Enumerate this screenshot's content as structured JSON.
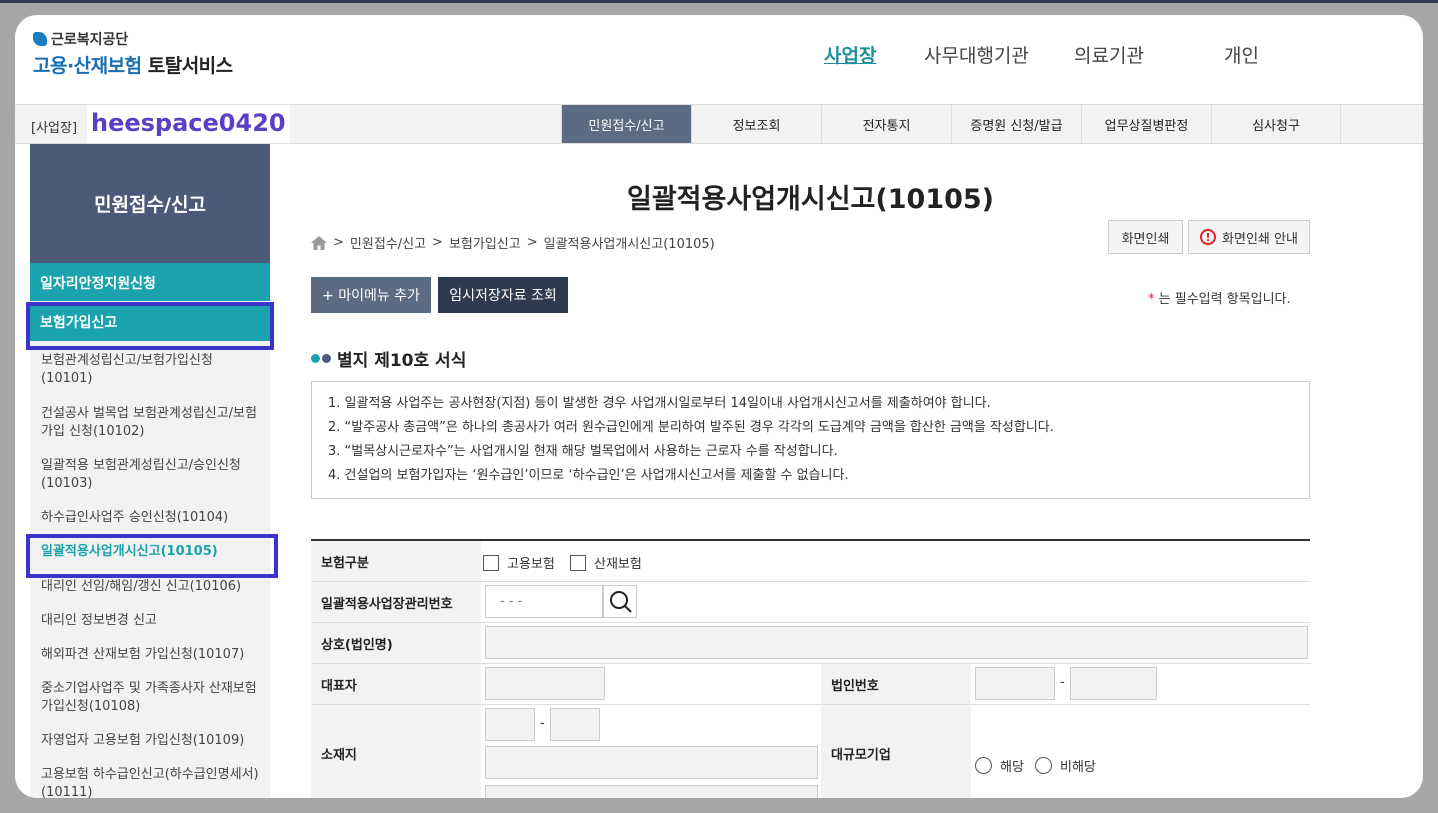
{
  "header": {
    "org_small": "근로복지공단",
    "logo_main_1": "고용·산재보험",
    "logo_main_2": "토탈서비스",
    "gnb": [
      {
        "label": "사업장"
      },
      {
        "label": "사무대행기관"
      },
      {
        "label": "의료기관"
      },
      {
        "label": "개인"
      }
    ]
  },
  "subbar": {
    "biz_label": "[사업장]",
    "user_id": "heespace0420",
    "tabs": [
      {
        "label": "민원접수/신고"
      },
      {
        "label": "정보조회"
      },
      {
        "label": "전자통지"
      },
      {
        "label": "증명원 신청/발급"
      },
      {
        "label": "업무상질병판정"
      },
      {
        "label": "심사청구"
      }
    ]
  },
  "lnb": {
    "head": "민원접수/신고",
    "category": "일자리안정지원신청",
    "sub": "보험가입신고",
    "items": [
      {
        "label": "보험관계성립신고/보험가입신청(10101)"
      },
      {
        "label": "건설공사 벌목업 보험관계성립신고/보험가입 신청(10102)"
      },
      {
        "label": "일괄적용 보험관계성립신고/승인신청(10103)"
      },
      {
        "label": "하수급인사업주 승인신청(10104)"
      },
      {
        "label": "일괄적용사업개시신고(10105)"
      },
      {
        "label": "대리인 선임/해임/갱신 신고(10106)"
      },
      {
        "label": "대리인 정보변경 신고"
      },
      {
        "label": "해외파견 산재보험 가입신청(10107)"
      },
      {
        "label": "중소기업사업주 및 가족종사자 산재보험가입신청(10108)"
      },
      {
        "label": "자영업자 고용보험 가입신청(10109)"
      },
      {
        "label": "고용보험 하수급인신고(하수급인명세서)(10111)"
      }
    ]
  },
  "main": {
    "title": "일괄적용사업개시신고(10105)",
    "breadcrumb": [
      "민원접수/신고",
      "보험가입신고",
      "일괄적용사업개시신고(10105)"
    ],
    "print_label": "화면인쇄",
    "print_guide_label": "화면인쇄 안내",
    "mymenu_label": "+ 마이메뉴 추가",
    "temp_label": "임시저장자료 조회",
    "req_note": "는 필수입력 항목입니다.",
    "req_star": "*",
    "section_title": "별지 제10호 서식",
    "notices": [
      "1. 일괄적용 사업주는 공사현장(지점) 등이 발생한 경우 사업개시일로부터 14일이내 사업개시신고서를 제출하여야 합니다.",
      "2. “발주공사 총금액”은 하나의 총공사가 여러 원수급인에게 분리하여 발주된 경우 각각의 도급계약 금액을 합산한 금액을 작성합니다.",
      "3. “벌목상시근로자수”는 사업개시일 현재 해당 벌목업에서 사용하는 근로자 수를 작성합니다.",
      "4. 건설업의 보험가입자는 ‘원수급인’이므로 ‘하수급인’은 사업개시신고서를 제출할 수 없습니다."
    ]
  },
  "form": {
    "insurance_type_label": "보험구분",
    "opt_employment": "고용보험",
    "opt_industrial": "산재보험",
    "mgmt_no_label": "일괄적용사업장관리번호",
    "mgmt_no_placeholder": "- -   -",
    "company_label": "상호(법인명)",
    "rep_label": "대표자",
    "corp_no_label": "법인번호",
    "dash": "-",
    "address_label": "소재지",
    "large_company_label": "대규모기업",
    "opt_applicable": "해당",
    "opt_not_applicable": "비해당"
  },
  "colors": {
    "accent": "#1aa3ac",
    "active_tab": "#5a6b82",
    "lnb_head": "#4a5a78",
    "highlight_box": "#3b34c8",
    "user_id": "#5b3fc4"
  }
}
